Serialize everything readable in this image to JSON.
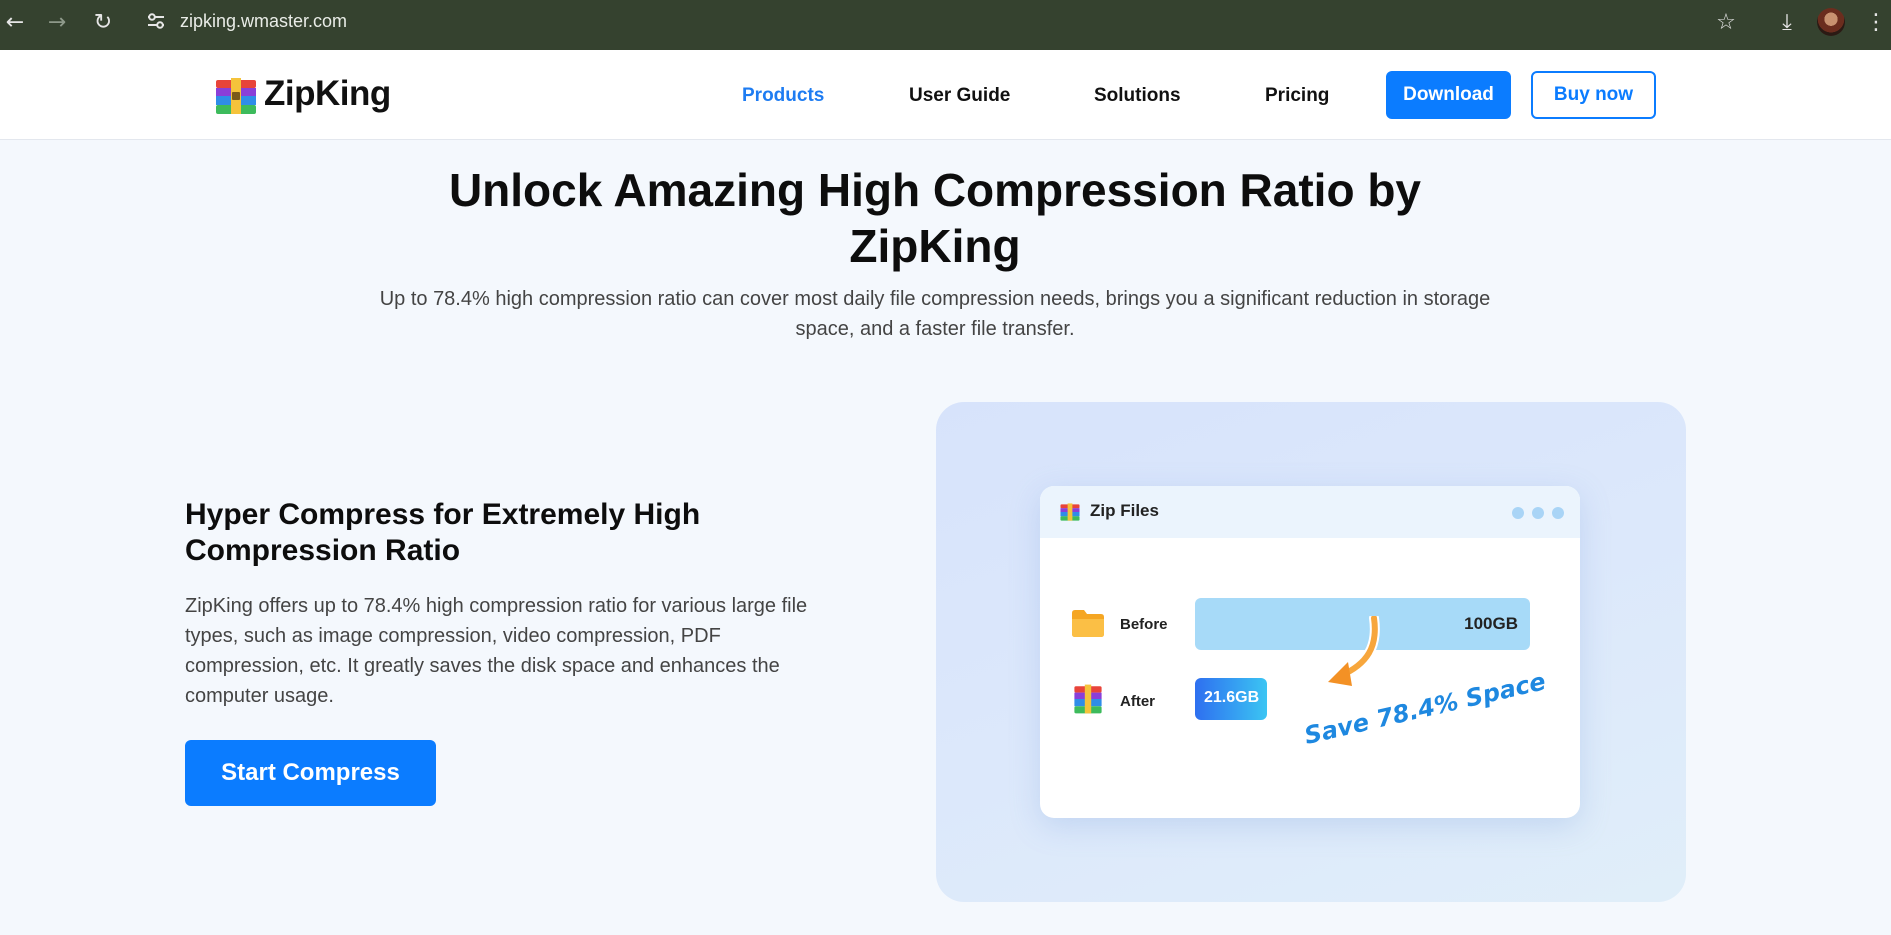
{
  "browser": {
    "url": "zipking.wmaster.com",
    "back_icon": "arrow-left-icon",
    "forward_icon": "arrow-right-icon",
    "reload_icon": "reload-icon",
    "site_info_icon": "tune-icon",
    "bookmark_icon": "star-icon",
    "download_icon": "download-icon",
    "menu_icon": "kebab-menu-icon"
  },
  "header": {
    "brand": "ZipKing",
    "nav": [
      "Products",
      "User Guide",
      "Solutions",
      "Pricing"
    ],
    "active_nav": "Products",
    "download_label": "Download",
    "buy_label": "Buy now",
    "accent_color": "#0b7cff"
  },
  "hero": {
    "title": "Unlock Amazing High Compression Ratio by ZipKing",
    "subtitle": "Up to 78.4% high compression ratio can cover most daily file compression needs, brings you a significant reduction in storage space, and a faster file transfer."
  },
  "feature": {
    "title": "Hyper Compress for Extremely High Compression Ratio",
    "body": "ZipKing offers up to 78.4% high compression ratio for various large file types, such as image compression, video compression, PDF compression, etc. It greatly saves the disk space and enhances the computer usage.",
    "cta_label": "Start Compress"
  },
  "illustration": {
    "window_title": "Zip Files",
    "before_label": "Before",
    "before_size": "100GB",
    "after_label": "After",
    "after_size": "21.6GB",
    "after_fraction": 0.216,
    "tagline": "Save 78.4% Space"
  }
}
